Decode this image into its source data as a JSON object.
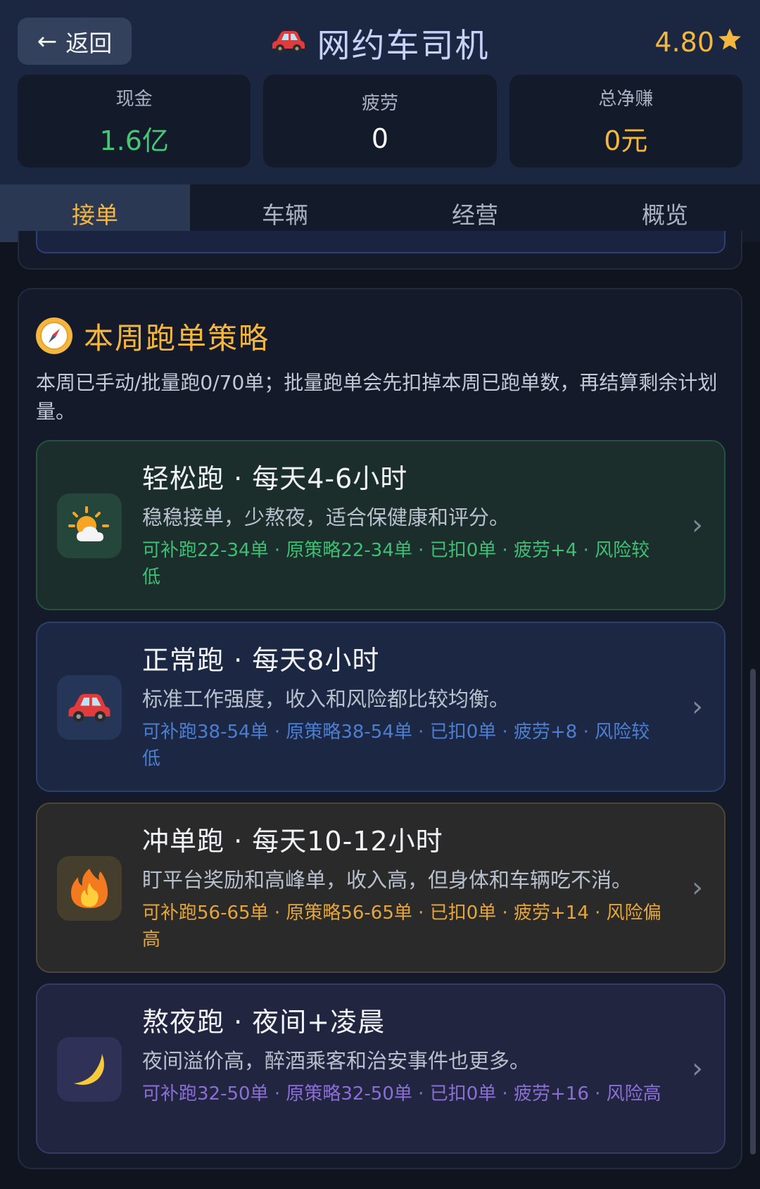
{
  "header": {
    "back_label": "返回",
    "title": "网约车司机",
    "rating": "4.80",
    "stats": [
      {
        "label": "现金",
        "value": "1.6亿"
      },
      {
        "label": "疲劳",
        "value": "0"
      },
      {
        "label": "总净赚",
        "value": "0元"
      }
    ]
  },
  "tabs": [
    {
      "label": "接单",
      "active": true
    },
    {
      "label": "车辆",
      "active": false
    },
    {
      "label": "经营",
      "active": false
    },
    {
      "label": "概览",
      "active": false
    }
  ],
  "section": {
    "title": "本周跑单策略",
    "description": "本周已手动/批量跑0/70单；批量跑单会先扣掉本周已跑单数，再结算剩余计划量。",
    "cards": [
      {
        "title": "轻松跑 · 每天4-6小时",
        "desc": "稳稳接单，少熬夜，适合保健康和评分。",
        "meta": "可补跑22-34单 · 原策略22-34单 · 已扣0单 · 疲劳+4 · 风险较低",
        "icon": "sun-cloud-icon",
        "accent": "#3fbf74"
      },
      {
        "title": "正常跑 · 每天8小时",
        "desc": "标准工作强度，收入和风险都比较均衡。",
        "meta": "可补跑38-54单 · 原策略38-54单 · 已扣0单 · 疲劳+8 · 风险较低",
        "icon": "car-icon",
        "accent": "#4c7ed2"
      },
      {
        "title": "冲单跑 · 每天10-12小时",
        "desc": "盯平台奖励和高峰单，收入高，但身体和车辆吃不消。",
        "meta": "可补跑56-65单 · 原策略56-65单 · 已扣0单 · 疲劳+14 · 风险偏高",
        "icon": "fire-icon",
        "accent": "#e6a63a"
      },
      {
        "title": "熬夜跑 · 夜间+凌晨",
        "desc": "夜间溢价高，醉酒乘客和治安事件也更多。",
        "meta": "可补跑32-50单 · 原策略32-50单 · 已扣0单 · 疲劳+16 · 风险高",
        "icon": "moon-icon",
        "accent": "#8b6fd6"
      }
    ]
  },
  "colors": {
    "accent_gold": "#f4b63e",
    "cash_green": "#45c775",
    "header_bg": "#1b2740"
  }
}
